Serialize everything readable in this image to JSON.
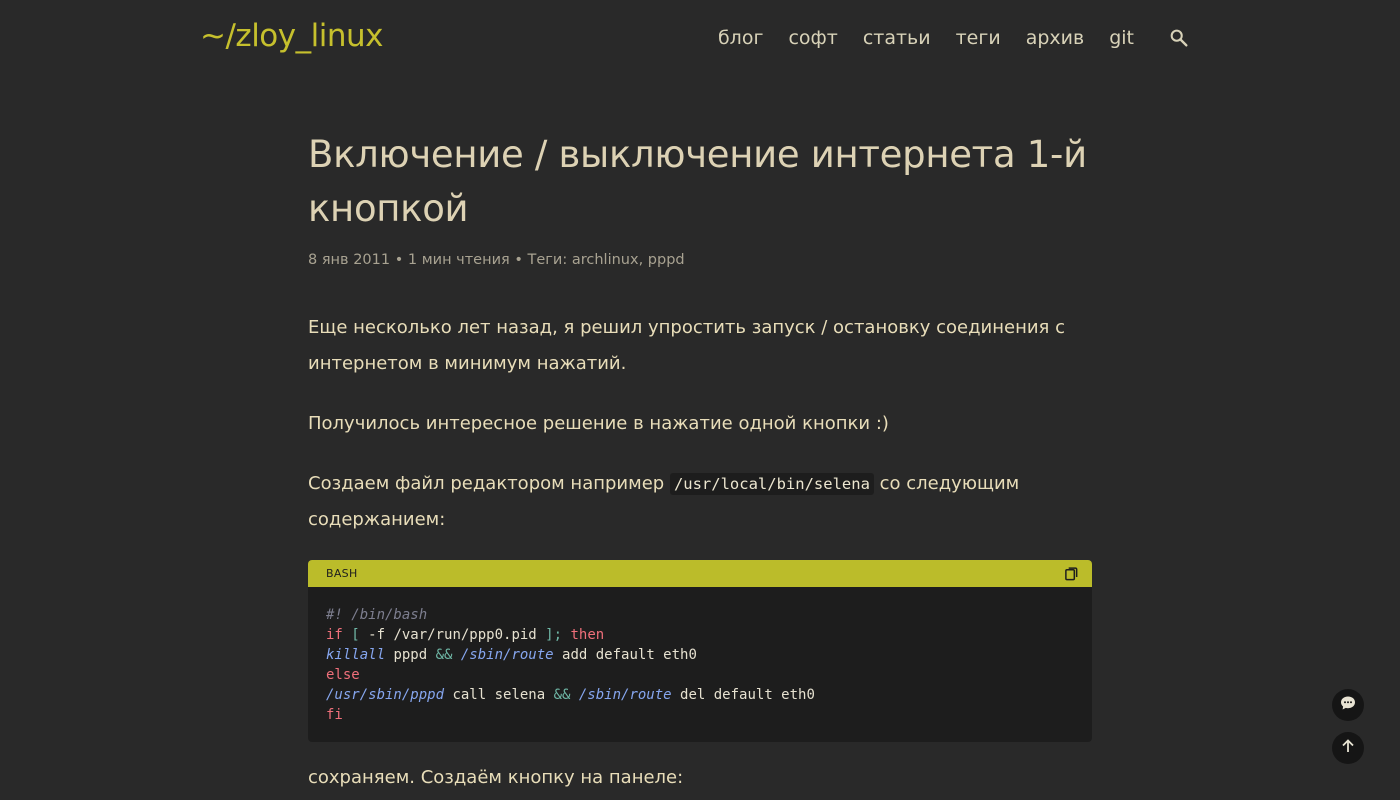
{
  "header": {
    "logo": "~/zloy_linux",
    "nav": [
      "блог",
      "софт",
      "статьи",
      "теги",
      "архив",
      "git"
    ],
    "search_icon": "search-icon"
  },
  "post": {
    "title": "Включение / выключение интернета 1-й кнопкой",
    "meta": {
      "date": "8 янв 2011",
      "sep1": " • ",
      "read_time": "1 мин чтения",
      "sep2": " • ",
      "tags_label": "Теги: ",
      "tags": [
        "archlinux",
        "pppd"
      ],
      "tag_sep": ", "
    },
    "paragraphs": {
      "p1": "Еще несколько лет назад, я решил упростить запуск / остановку соединения с интернетом в минимум нажатий.",
      "p2": "Получилось интересное решение в нажатие одной кнопки :)",
      "p3_before": "Создаем файл редактором например ",
      "p3_code": "/usr/local/bin/selena",
      "p3_after": " со следующим содержанием:",
      "p4": "сохраняем. Создаём кнопку на панеле:"
    },
    "code_block": {
      "language": "BASH",
      "copy_icon": "copy-icon",
      "lines": {
        "l1": "#! /bin/bash",
        "l2_if": "if",
        "l2_test": " [ ",
        "l2_flag": "-f",
        "l2_path": " /var/run/ppp0.pid ",
        "l2_close": "];",
        "l2_then": " then",
        "l3_cmd": "killall",
        "l3_arg": " pppd ",
        "l3_op": "&&",
        "l3_cmd2": " /sbin/route",
        "l3_rest": " add default eth0",
        "l4": "else",
        "l5_cmd": "/usr/sbin/pppd",
        "l5_arg": " call selena ",
        "l5_op": "&&",
        "l5_cmd2": " /sbin/route",
        "l5_rest": " del default eth0",
        "l6": "fi"
      }
    }
  },
  "floating": {
    "comments_icon": "comments-icon",
    "scroll_top_icon": "arrow-up-icon"
  },
  "colors": {
    "background": "#292929",
    "accent": "#c6c02d",
    "code_bar": "#bbbc2a"
  }
}
